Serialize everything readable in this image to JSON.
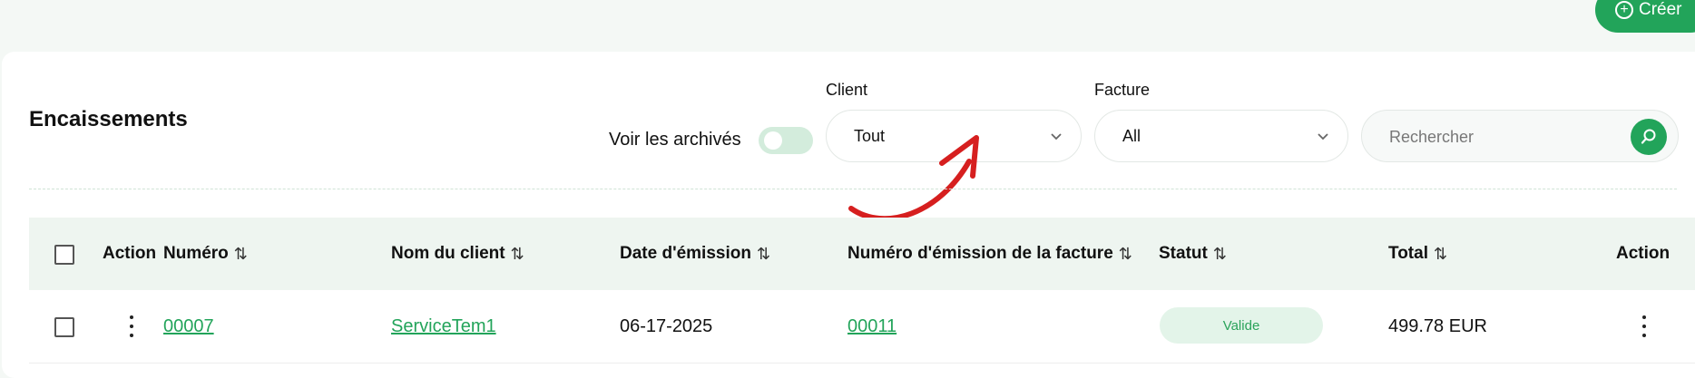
{
  "header": {
    "create_label": "Créer"
  },
  "page": {
    "title": "Encaissements"
  },
  "filters": {
    "archive_label": "Voir les archivés",
    "archive_toggle_on": false,
    "client": {
      "label": "Client",
      "value": "Tout"
    },
    "invoice": {
      "label": "Facture",
      "value": "All"
    },
    "search": {
      "placeholder": "Rechercher"
    }
  },
  "table": {
    "columns": [
      {
        "label": "Action"
      },
      {
        "label": "Numéro"
      },
      {
        "label": "Nom du client"
      },
      {
        "label": "Date d'émission"
      },
      {
        "label": "Numéro d'émission de la facture"
      },
      {
        "label": "Statut"
      },
      {
        "label": "Total"
      },
      {
        "label": "Action"
      }
    ],
    "sort_icon": "⇅",
    "rows": [
      {
        "numero": "00007",
        "client": "ServiceTem1",
        "date": "06-17-2025",
        "invoice_number": "00011",
        "status": "Valide",
        "total": "499.78 EUR"
      }
    ]
  },
  "colors": {
    "accent": "#22a45a",
    "annotation": "#d61f1f"
  }
}
